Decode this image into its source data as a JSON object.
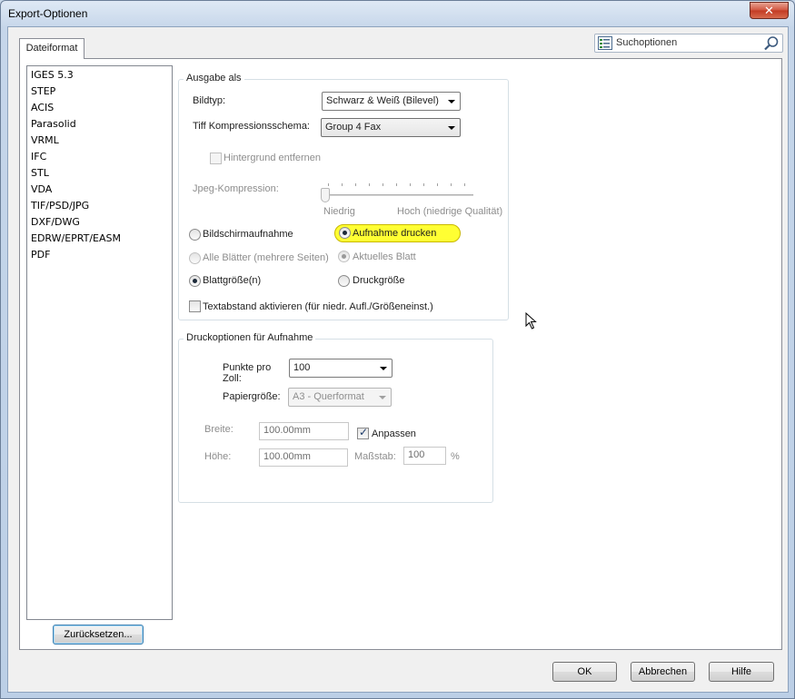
{
  "window": {
    "title": "Export-Optionen",
    "close_glyph": "✕"
  },
  "tab": {
    "label": "Dateiformat"
  },
  "search": {
    "placeholder": "Suchoptionen",
    "icon": "search-icon"
  },
  "formats": [
    "IGES 5.3",
    "STEP",
    "ACIS",
    "Parasolid",
    "VRML",
    "IFC",
    "STL",
    "VDA",
    "TIF/PSD/JPG",
    "DXF/DWG",
    "EDRW/EPRT/EASM",
    "PDF"
  ],
  "selected_format": "TIF/PSD/JPG",
  "reset_button": "Zurücksetzen...",
  "ausgabe": {
    "legend": "Ausgabe als",
    "bildtyp_label": "Bildtyp:",
    "bildtyp_value": "Schwarz & Weiß (Bilevel)",
    "tiff_label": "Tiff Kompressionsschema:",
    "tiff_value": "Group 4 Fax",
    "hintergrund_label": "Hintergrund entfernen",
    "jpeg_label": "Jpeg-Kompression:",
    "slider_low": "Niedrig",
    "slider_high": "Hoch (niedrige Qualität)",
    "radio_bildschirm": "Bildschirmaufnahme",
    "radio_aufnahme": "Aufnahme drucken",
    "radio_alle": "Alle Blätter (mehrere Seiten)",
    "radio_aktuell": "Aktuelles Blatt",
    "radio_blattgroesse": "Blattgröße(n)",
    "radio_druckgroesse": "Druckgröße",
    "textabstand_label": "Textabstand aktivieren (für niedr. Aufl./Größeneinst.)"
  },
  "druck": {
    "legend": "Druckoptionen für Aufnahme",
    "dpi_label_1": "Punkte pro",
    "dpi_label_2": "Zoll:",
    "dpi_value": "100",
    "papier_label": "Papiergröße:",
    "papier_value": "A3 - Querformat",
    "breite_label": "Breite:",
    "breite_value": "100.00mm",
    "hoehe_label": "Höhe:",
    "hoehe_value": "100.00mm",
    "anpassen_label": "Anpassen",
    "massstab_label": "Maßstab:",
    "massstab_value": "100",
    "percent": "%"
  },
  "footer": {
    "ok": "OK",
    "abbrechen": "Abbrechen",
    "hilfe": "Hilfe"
  }
}
